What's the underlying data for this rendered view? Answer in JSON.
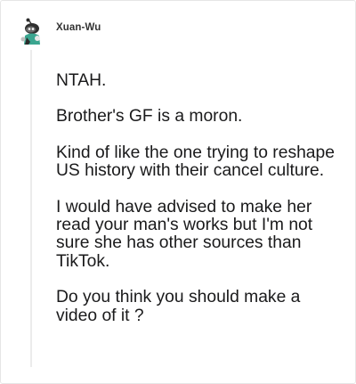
{
  "comment": {
    "author": "Xuan-Wu",
    "avatar_icon": "snoo-avatar-icon",
    "paragraphs": [
      "NTAH.",
      "Brother's GF is a moron.",
      "Kind of like the one trying to reshape US history with their cancel culture.",
      "I would have advised to make her read your man's works but I'm not sure she has other sources than TikTok.",
      "Do you think you should make a video of it ?"
    ]
  }
}
